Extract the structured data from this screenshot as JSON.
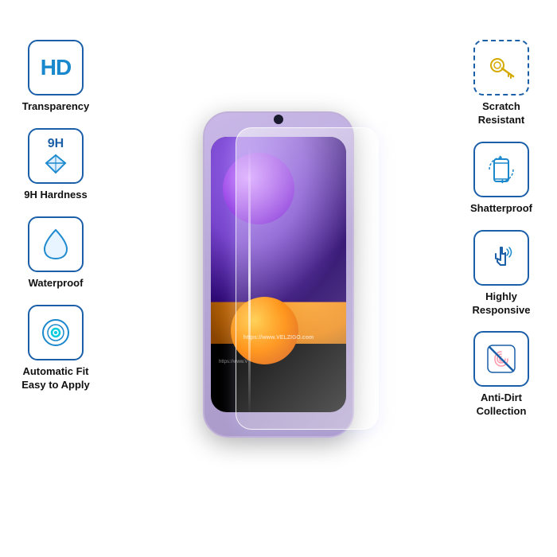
{
  "features_left": [
    {
      "id": "hd-transparency",
      "label": "Transparency",
      "icon_type": "hd"
    },
    {
      "id": "9h-hardness",
      "label": "9H Hardness",
      "icon_type": "9h"
    },
    {
      "id": "waterproof",
      "label": "Waterproof",
      "icon_type": "water"
    },
    {
      "id": "auto-fit",
      "label": "Automatic Fit\nEasy to Apply",
      "icon_type": "target"
    }
  ],
  "features_right": [
    {
      "id": "scratch-resistant",
      "label": "Scratch\nResistant",
      "icon_type": "key"
    },
    {
      "id": "shatterproof",
      "label": "Shatterproof",
      "icon_type": "rotate"
    },
    {
      "id": "highly-responsive",
      "label": "Highly\nResponsive",
      "icon_type": "touch"
    },
    {
      "id": "anti-dirt",
      "label": "Anti-Dirt\nCollection",
      "icon_type": "fingerprint"
    }
  ],
  "watermark": "https://www.VELZIGO.com",
  "watermark2": "https://www.V",
  "brand": "VELZIGO",
  "colors": {
    "icon_border": "#1a5fa8",
    "icon_accent": "#1a88cc",
    "label": "#111111"
  }
}
